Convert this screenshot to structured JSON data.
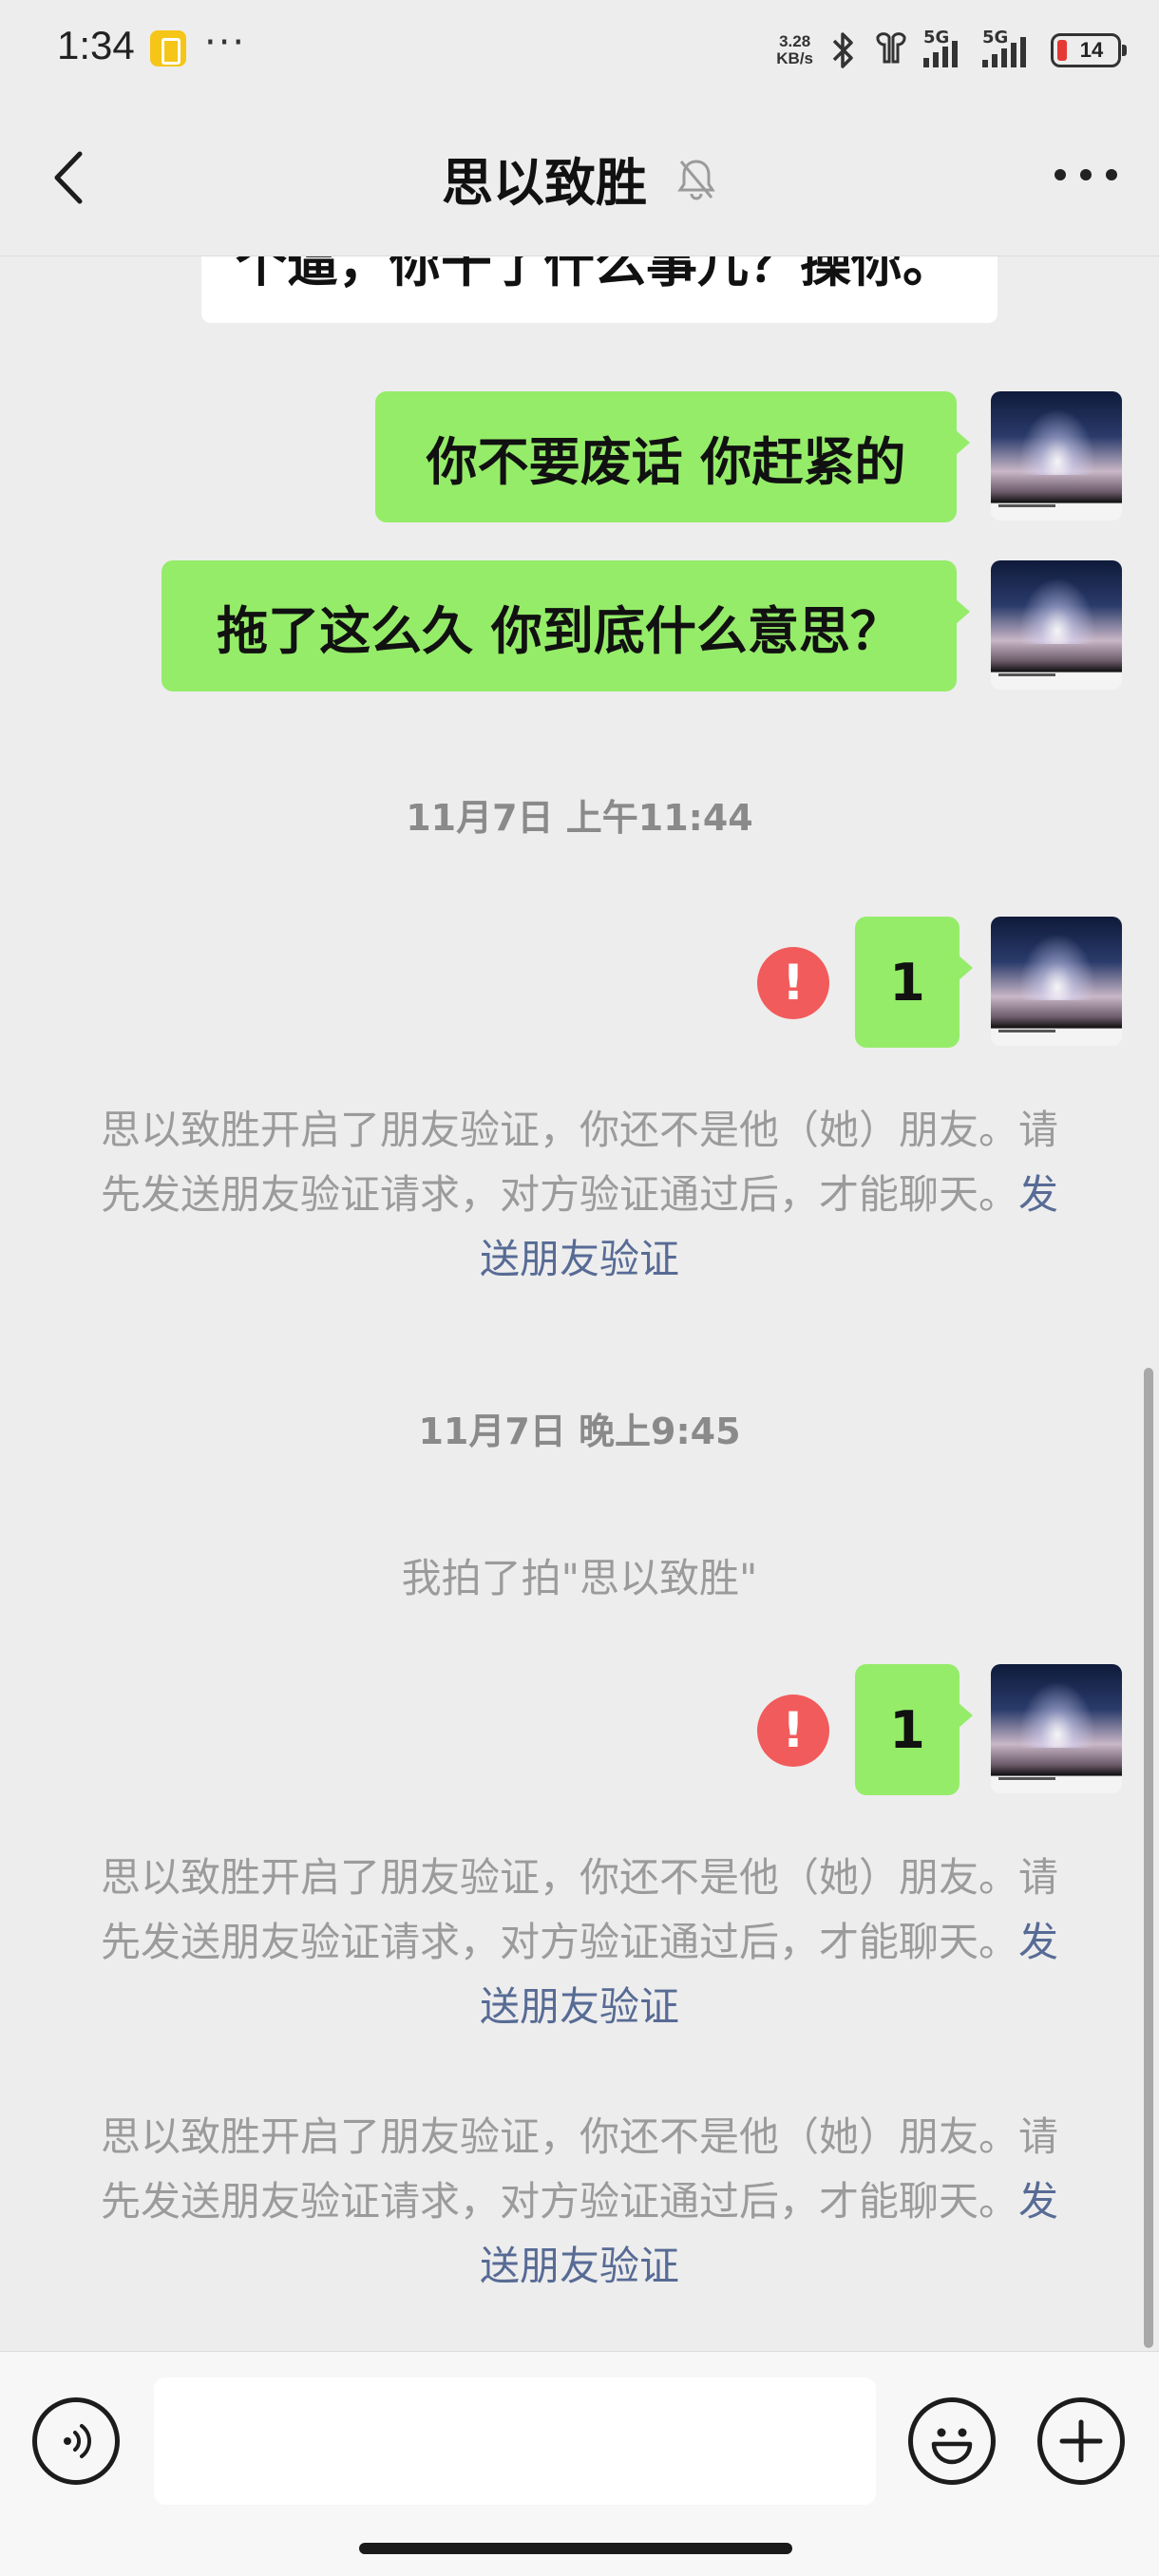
{
  "status_bar": {
    "time": "1:34",
    "more": "···",
    "net_speed_value": "3.28",
    "net_speed_unit": "KB/s",
    "signal_1": "5G",
    "signal_2": "5G",
    "battery": "14"
  },
  "header": {
    "title": "思以致胜",
    "muted": true
  },
  "messages": {
    "incoming_partial": "个逼，你干了什么事儿？操你。",
    "out_1": "你不要废话 你赶紧的",
    "out_2": "拖了这么久 你到底什么意思？",
    "timestamp_1": "11月7日 上午11:44",
    "out_3": "1",
    "error_1": "!",
    "system_1_text": "思以致胜开启了朋友验证，你还不是他（她）朋友。请先发送朋友验证请求，对方验证通过后，才能聊天。",
    "system_1_link": "发送朋友验证",
    "timestamp_2": "11月7日 晚上9:45",
    "pat": "我拍了拍\"思以致胜\"",
    "out_4": "1",
    "error_2": "!",
    "system_2_text": "思以致胜开启了朋友验证，你还不是他（她）朋友。请先发送朋友验证请求，对方验证通过后，才能聊天。",
    "system_2_link": "发送朋友验证",
    "system_3_text": "思以致胜开启了朋友验证，你还不是他（她）朋友。请先发送朋友验证请求，对方验证通过后，才能聊天。",
    "system_3_link": "发送朋友验证"
  },
  "input": {
    "value": "",
    "placeholder": ""
  },
  "colors": {
    "outgoing_bubble": "#95ec69",
    "error": "#f25b5b",
    "link": "#576b95",
    "background": "#ededed"
  }
}
